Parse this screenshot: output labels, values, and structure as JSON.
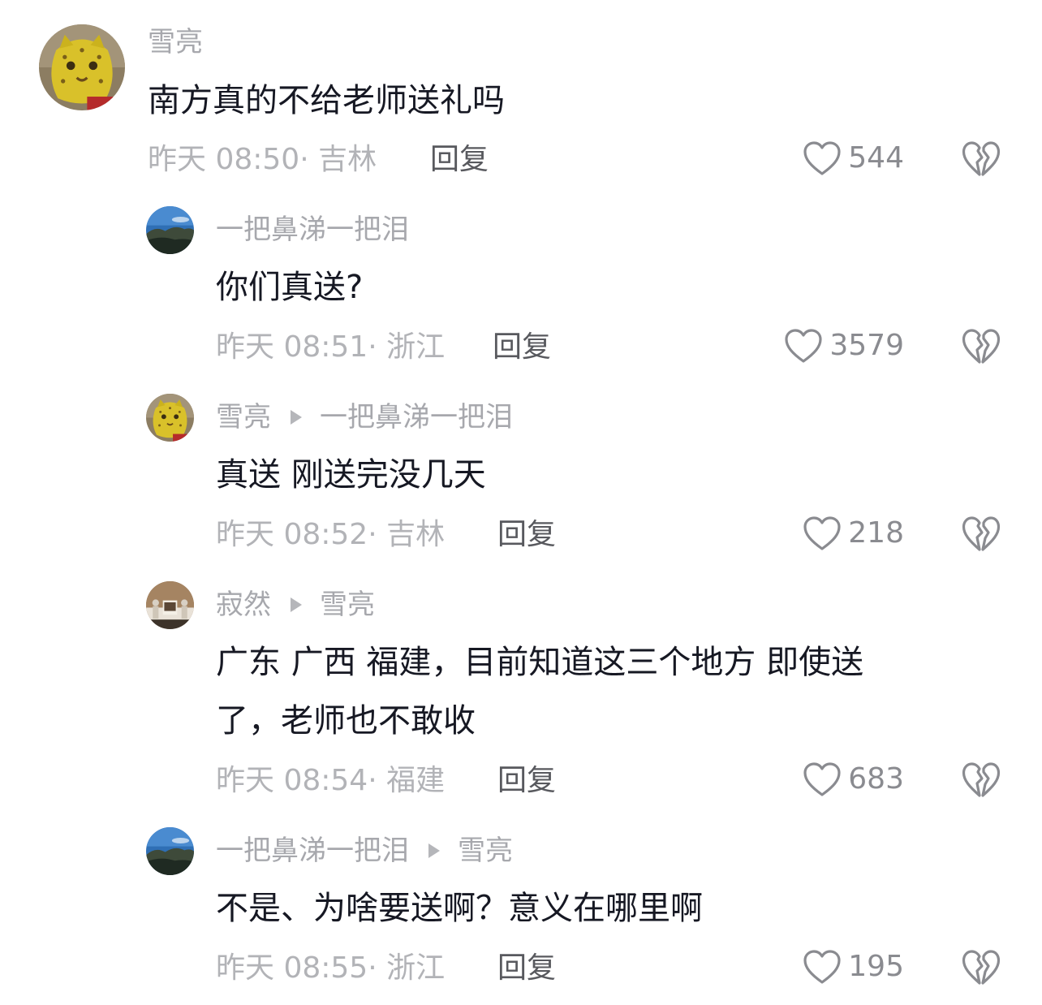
{
  "comments": [
    {
      "author": "雪亮",
      "reply_to": "",
      "text": "南方真的不给老师送礼吗",
      "text_line2": "",
      "time": "昨天 08:50",
      "location": "吉林",
      "reply_label": "回复",
      "likes": "544",
      "avatar": "leopard-avatar"
    },
    {
      "author": "一把鼻涕一把泪",
      "reply_to": "",
      "text": "你们真送?",
      "text_line2": "",
      "time": "昨天 08:51",
      "location": "浙江",
      "reply_label": "回复",
      "likes": "3579",
      "avatar": "mountain-sky-avatar"
    },
    {
      "author": "雪亮",
      "reply_to": "一把鼻涕一把泪",
      "text": "真送 刚送完没几天",
      "text_line2": "",
      "time": "昨天 08:52",
      "location": "吉林",
      "reply_label": "回复",
      "likes": "218",
      "avatar": "leopard-avatar"
    },
    {
      "author": "寂然",
      "reply_to": "雪亮",
      "text": "广东 广西 福建，目前知道这三个地方 即使送",
      "text_line2": "了，老师也不敢收",
      "time": "昨天 08:54",
      "location": "福建",
      "reply_label": "回复",
      "likes": "683",
      "avatar": "statues-avatar"
    },
    {
      "author": "一把鼻涕一把泪",
      "reply_to": "雪亮",
      "text": "不是、为啥要送啊？意义在哪里啊",
      "text_line2": "",
      "time": "昨天 08:55",
      "location": "浙江",
      "reply_label": "回复",
      "likes": "195",
      "avatar": "mountain-sky-avatar"
    }
  ],
  "meta_separator": "· ",
  "icons": {
    "like": "heart-outline-icon",
    "dislike": "broken-heart-icon",
    "reply_arrow": "play-triangle-icon"
  },
  "colors": {
    "text": "#161823",
    "name": "#a7a8ad",
    "meta": "#b2b3b7",
    "reply": "#58595e",
    "icon": "#8a8b90"
  }
}
